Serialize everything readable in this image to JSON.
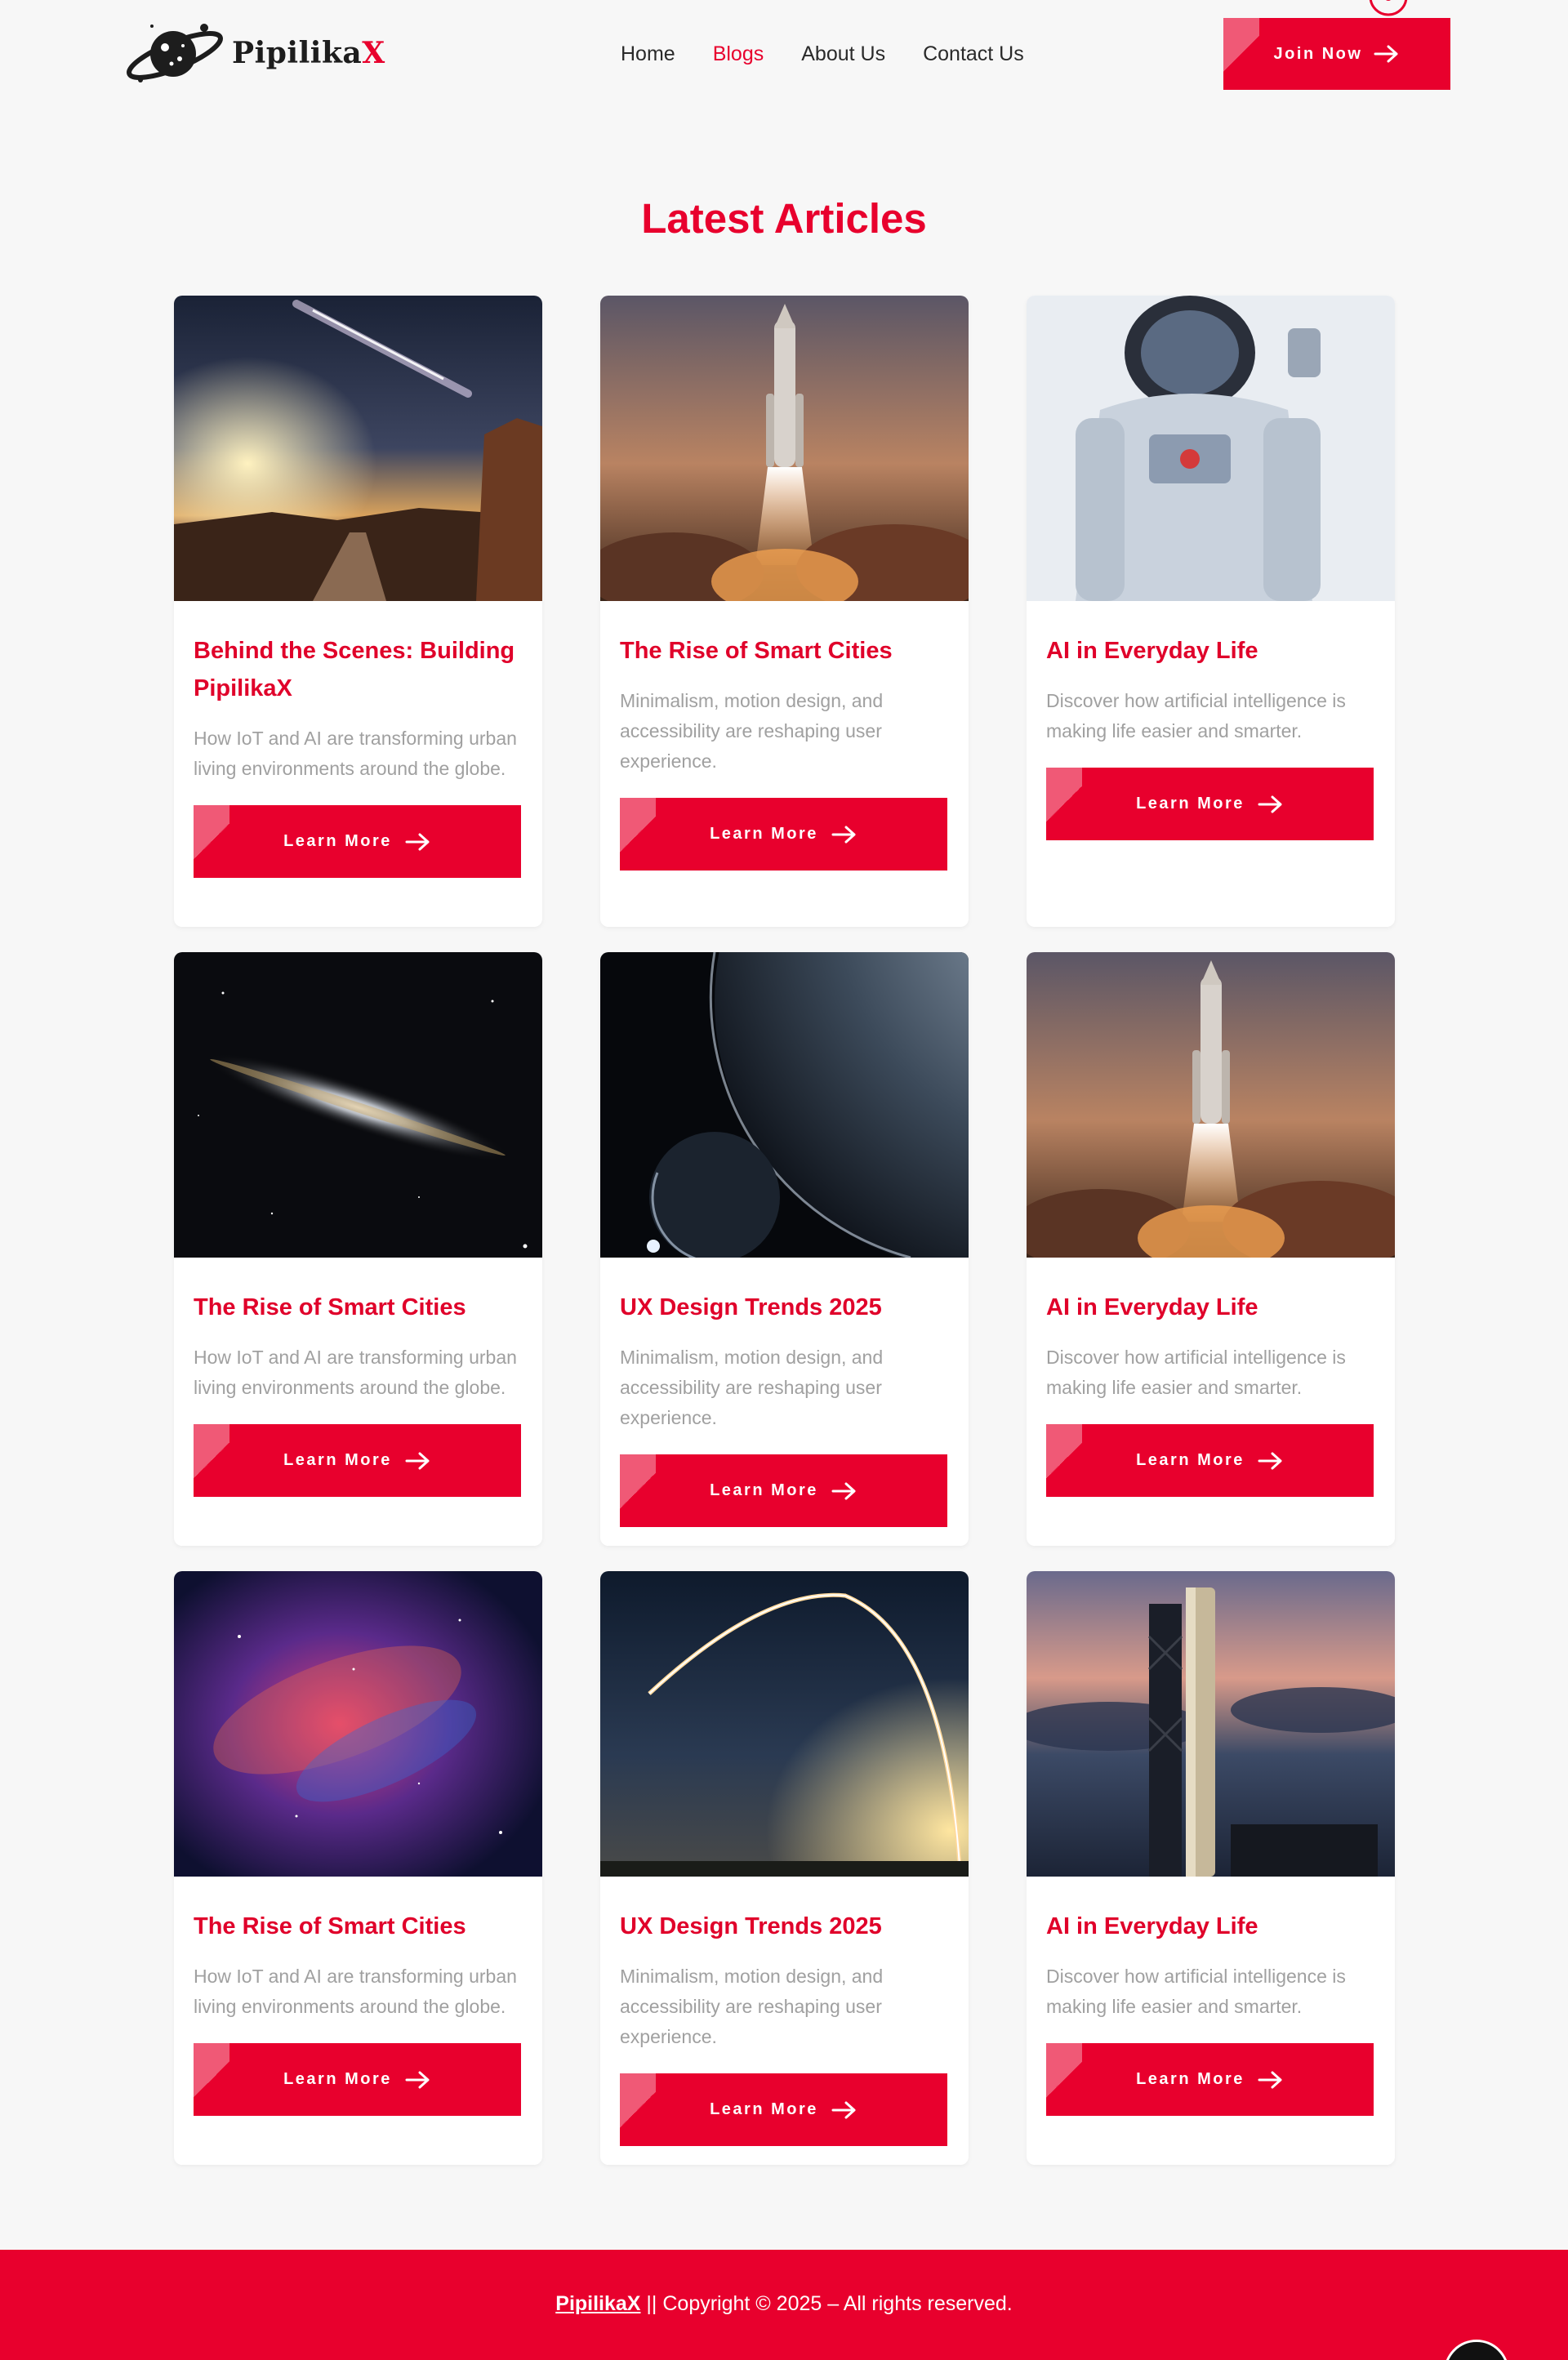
{
  "header": {
    "brand": "Pipilika",
    "brand_accent": "X",
    "nav": [
      {
        "label": "Home",
        "active": false
      },
      {
        "label": "Blogs",
        "active": true
      },
      {
        "label": "About Us",
        "active": false
      },
      {
        "label": "Contact Us",
        "active": false
      }
    ],
    "join_label": "Join Now"
  },
  "main": {
    "title": "Latest Articles",
    "cards": [
      {
        "title": "Behind the Scenes: Building PipilikaX",
        "desc": "How IoT and AI are transforming urban living environments around the globe.",
        "button": "Learn More",
        "image": "desert-milky-way"
      },
      {
        "title": "The Rise of Smart Cities",
        "desc": "Minimalism, motion design, and accessibility are reshaping user experience.",
        "button": "Learn More",
        "image": "rocket-launch"
      },
      {
        "title": "AI in Everyday Life",
        "desc": "Discover how artificial intelligence is making life easier and smarter.",
        "button": "Learn More",
        "image": "astronaut"
      },
      {
        "title": "The Rise of Smart Cities",
        "desc": "How IoT and AI are transforming urban living environments around the globe.",
        "button": "Learn More",
        "image": "galaxy"
      },
      {
        "title": "UX Design Trends 2025",
        "desc": "Minimalism, motion design, and accessibility are reshaping user experience.",
        "button": "Learn More",
        "image": "planet"
      },
      {
        "title": "AI in Everyday Life",
        "desc": "Discover how artificial intelligence is making life easier and smarter.",
        "button": "Learn More",
        "image": "rocket-launch"
      },
      {
        "title": "The Rise of Smart Cities",
        "desc": "How IoT and AI are transforming urban living environments around the globe.",
        "button": "Learn More",
        "image": "nebula"
      },
      {
        "title": "UX Design Trends 2025",
        "desc": "Minimalism, motion design, and accessibility are reshaping user experience.",
        "button": "Learn More",
        "image": "rocket-trail"
      },
      {
        "title": "AI in Everyday Life",
        "desc": "Discover how artificial intelligence is making life easier and smarter.",
        "button": "Learn More",
        "image": "launch-tower"
      }
    ]
  },
  "footer": {
    "brand": "PipilikaX",
    "text": " || Copyright © 2025 – All rights reserved."
  },
  "colors": {
    "accent": "#e8002d",
    "background": "#f7f7f7",
    "muted_text": "#a0a0a0"
  }
}
